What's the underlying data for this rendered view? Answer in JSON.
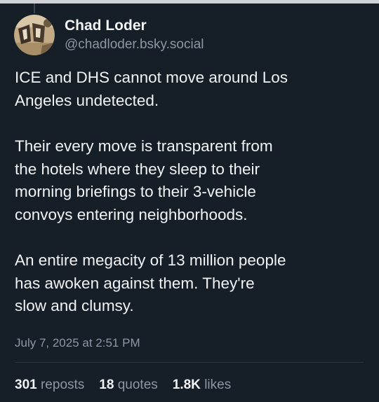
{
  "post": {
    "author": {
      "display_name": "Chad Loder",
      "handle": "@chadloder.bsky.social",
      "avatar_icon": "avatar-image"
    },
    "paragraphs": [
      "ICE and DHS cannot move around Los\nAngeles undetected.",
      "Their every move is transparent from\nthe hotels where they sleep to their\nmorning briefings to their 3-vehicle\nconvoys entering neighborhoods.",
      "An entire megacity of 13 million people\nhas awoken against them. They're\nslow and clumsy."
    ],
    "timestamp": "July 7, 2025 at 2:51 PM",
    "stats": {
      "reposts_count": "301",
      "reposts_label": "reposts",
      "quotes_count": "18",
      "quotes_label": "quotes",
      "likes_count": "1.8K",
      "likes_label": "likes"
    }
  },
  "theme": {
    "background": "#161e27",
    "text": "#f1f3f5",
    "muted": "#8c98a6"
  }
}
